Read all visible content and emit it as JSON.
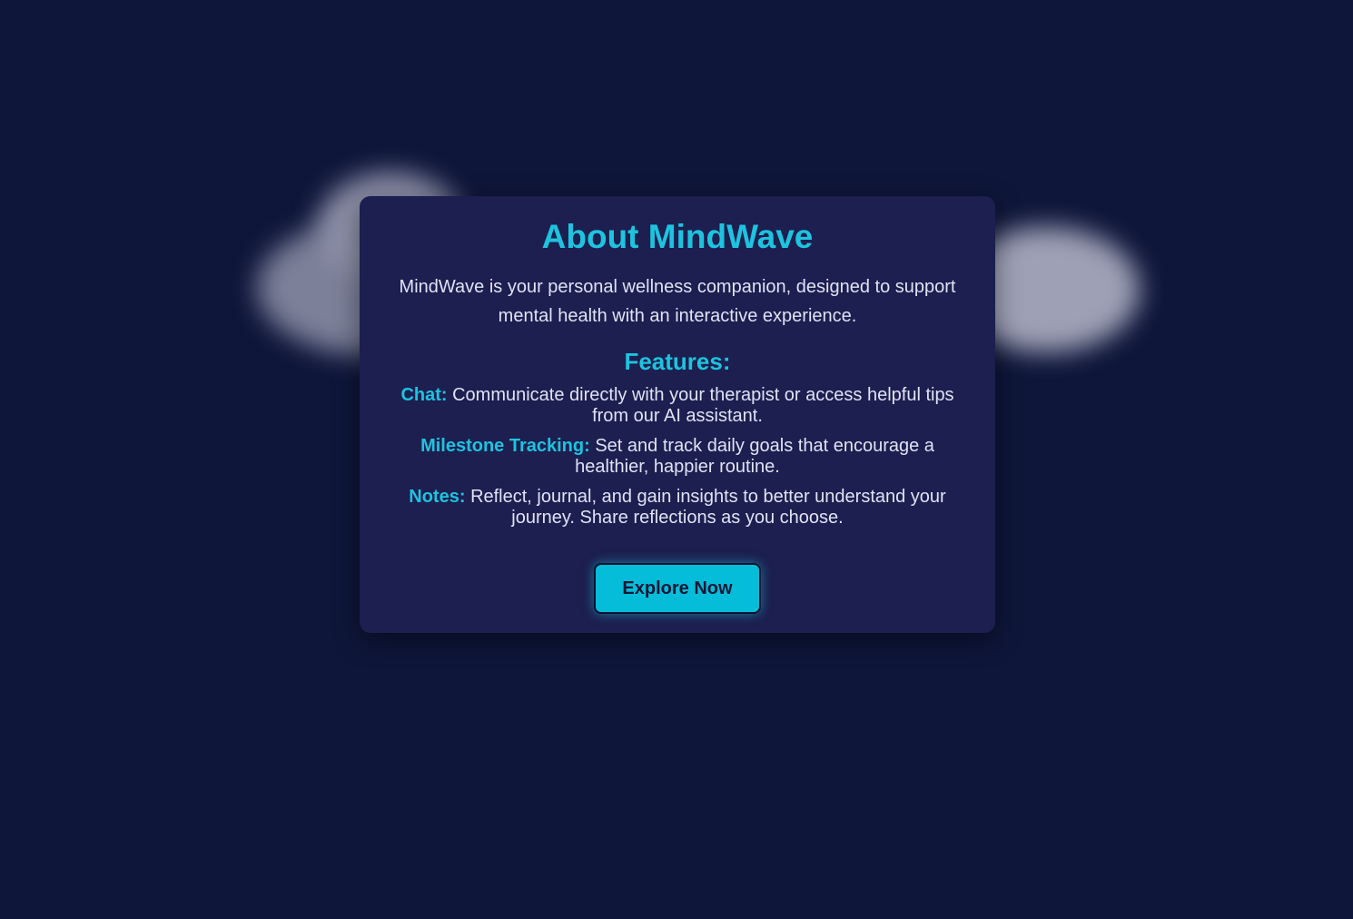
{
  "card": {
    "title": "About MindWave",
    "intro": "MindWave is your personal wellness companion, designed to support mental health with an interactive experience.",
    "features_heading": "Features:",
    "features": [
      {
        "name": "Chat:",
        "description": "Communicate directly with your therapist or access helpful tips from our AI assistant."
      },
      {
        "name": "Milestone Tracking:",
        "description": "Set and track daily goals that encourage a healthier, happier routine."
      },
      {
        "name": "Notes:",
        "description": "Reflect, journal, and gain insights to better understand your journey. Share reflections as you choose."
      }
    ],
    "cta_label": "Explore Now"
  },
  "colors": {
    "background": "#0e163a",
    "card": "#1c1f4f",
    "accent": "#1dc3df",
    "button": "#05bdd8",
    "text": "#dfe3f5"
  }
}
